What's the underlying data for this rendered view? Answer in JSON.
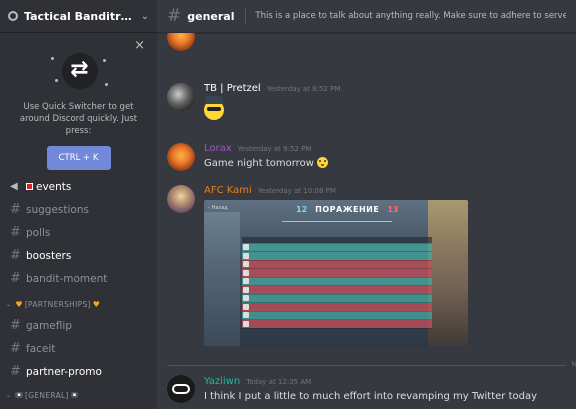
{
  "server": {
    "name": "Tactical Banditry | Offi...",
    "chevron": "chevron-down-icon"
  },
  "quick_switcher": {
    "text": "Use Quick Switcher to get around Discord quickly. Just press:",
    "button": "CTRL + K",
    "close": "×"
  },
  "channels": [
    {
      "name": "events",
      "bold": true,
      "prefix": "📢",
      "badge": "🟥"
    },
    {
      "name": "suggestions",
      "bold": false
    },
    {
      "name": "polls",
      "bold": false
    },
    {
      "name": "boosters",
      "bold": true
    },
    {
      "name": "bandit-moment",
      "bold": false
    }
  ],
  "categories": {
    "partnerships": "[PARTNERSHIPS]",
    "general": "[GENERAL]"
  },
  "partner_channels": [
    {
      "name": "gameflip",
      "bold": false
    },
    {
      "name": "faceit",
      "bold": false
    },
    {
      "name": "partner-promo",
      "bold": true
    }
  ],
  "header": {
    "channel": "general",
    "topic": "This is a place to talk about anything really. Make sure to adhere to server rules."
  },
  "messages": [
    {
      "author": "TB | Pretzel",
      "author_color": "#ffffff",
      "time": "Yesterday at 8:52 PM",
      "content": ""
    },
    {
      "author": "Lorax",
      "author_color": "#9b59b6",
      "time": "Yesterday at 9:52 PM",
      "content": "Game night tomorrow"
    },
    {
      "author": "AFC Kami",
      "author_color": "#e67e22",
      "time": "Yesterday at 10:08 PM",
      "content": ""
    },
    {
      "author": "Yaziiwn",
      "author_color": "#1abc9c",
      "time": "Today at 12:35 AM",
      "content": "I think I put a little to much effort into revamping my Twitter today"
    }
  ],
  "game_screenshot": {
    "score_left": "12",
    "result": "ПОРАЖЕНИЕ",
    "score_right": "13",
    "back_label": "‹ Назад",
    "rows": [
      "blue",
      "blue",
      "blue",
      "blue",
      "blue",
      "red",
      "red",
      "red",
      "red",
      "red"
    ]
  },
  "new_marker": "N"
}
